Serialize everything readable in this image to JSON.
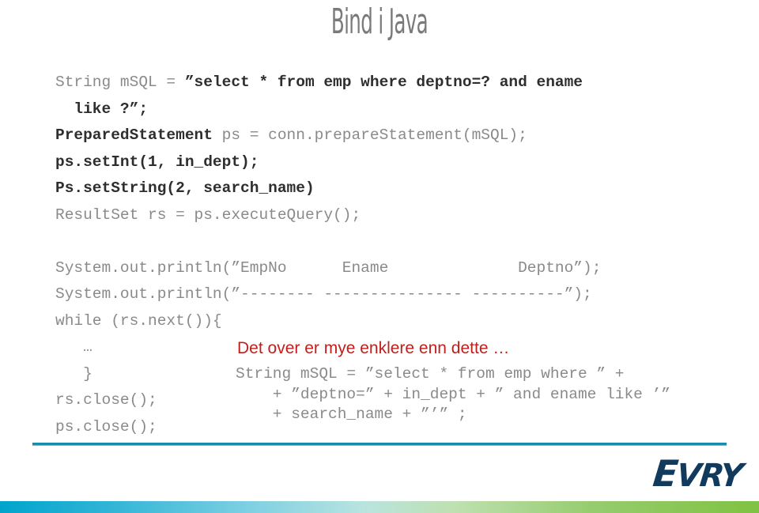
{
  "slide": {
    "title": "Bind i Java"
  },
  "code_main": {
    "lines": [
      [
        {
          "text": "String mSQL = ",
          "style": "gray"
        },
        {
          "text": "”select * from emp where deptno=? and ename",
          "style": "bold"
        }
      ],
      [
        {
          "text": "  like ?”;",
          "style": "bold"
        }
      ],
      [
        {
          "text": "PreparedStatement ",
          "style": "bold"
        },
        {
          "text": "ps = conn.prepareStatement(mSQL);",
          "style": "gray"
        }
      ],
      [
        {
          "text": "ps.setInt(1, in_dept);",
          "style": "bold"
        }
      ],
      [
        {
          "text": "Ps.setString(2, search_name)",
          "style": "bold"
        }
      ],
      [
        {
          "text": "ResultSet rs = ps.executeQuery();",
          "style": "gray"
        }
      ],
      [
        {
          "text": "",
          "style": "gray"
        }
      ],
      [
        {
          "text": "System.out.println(”EmpNo      Ename              Deptno”);",
          "style": "gray"
        }
      ],
      [
        {
          "text": "System.out.println(”-------- --------------- ----------”);",
          "style": "gray"
        }
      ],
      [
        {
          "text": "while (rs.next()){",
          "style": "gray"
        }
      ]
    ]
  },
  "code_lower_left": {
    "lines": [
      "   …",
      "   }",
      "rs.close();",
      "ps.close();"
    ]
  },
  "callout": {
    "text": "Det over er mye enklere enn dette …"
  },
  "code_lower_right": {
    "lines": [
      "String mSQL = ”select * from emp where ” +",
      "    + ”deptno=” + in_dept + ” and ename like ’”",
      "    + search_name + ”’” ;"
    ]
  },
  "footer": {
    "logo_cap": "E",
    "logo_rest": "VRY"
  },
  "colors": {
    "title": "#7a7a7a",
    "code_gray": "#8a8a8a",
    "code_bold": "#2e2e2e",
    "callout_red": "#C0201C",
    "divider": "#1b8bab",
    "logo_navy": "#113A5C",
    "bar_start": "#00a4cc",
    "bar_end": "#80c242"
  }
}
